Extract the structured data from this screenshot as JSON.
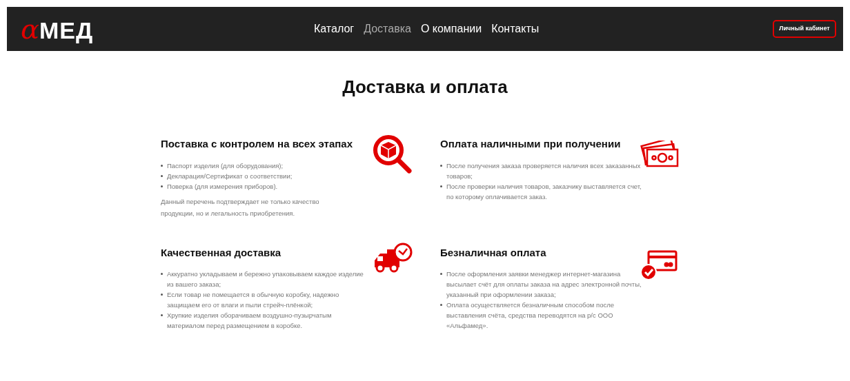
{
  "header": {
    "logo": {
      "alpha": "α",
      "text": "МЕД"
    },
    "nav": [
      {
        "label": "Каталог",
        "selected": false
      },
      {
        "label": "Доставка",
        "selected": true
      },
      {
        "label": "О компании",
        "selected": false
      },
      {
        "label": "Контакты",
        "selected": false
      }
    ],
    "account_button": "Личный кабинет"
  },
  "title": "Доставка и оплата",
  "cards": [
    {
      "kind": "inspect",
      "heading": "Поставка с контролем на всех этапах",
      "bullets": [
        "Паспорт изделия (для оборудования);",
        "Декларация/Сертификат о соответствии;",
        "Поверка (для измерения приборов)."
      ],
      "note": "Данный перечень подтверждает не только качество продукции, но и легальность приобретения."
    },
    {
      "kind": "cash",
      "heading": "Оплата наличными при получении",
      "bullets": [
        "После получения заказа проверяется наличия всех заказанных товаров;",
        "После проверки наличия товаров, заказчику выставляется счет, по которому оплачивается заказ."
      ]
    },
    {
      "kind": "truck",
      "heading": "Качественная доставка",
      "bullets": [
        "Аккуратно укладываем и бережно упаковываем каждое изделие из вашего заказа;",
        "Если товар не помещается в обычную коробку, надежно защищаем его от влаги и пыли стрейч-плёнкой;",
        "Хрупкие изделия оборачиваем воздушно-пузырчатым материалом перед размещением в коробке."
      ]
    },
    {
      "kind": "card",
      "heading": "Безналичная оплата",
      "bullets": [
        "После оформления заявки менеджер интернет-магазина высылает счёт для оплаты заказа на адрес электронной почты, указанный при оформлении заказа;",
        "Оплата осуществляется безналичным способом после выставления счёта, средства переводятся на р/с ООО «Альфамед»."
      ]
    }
  ]
}
